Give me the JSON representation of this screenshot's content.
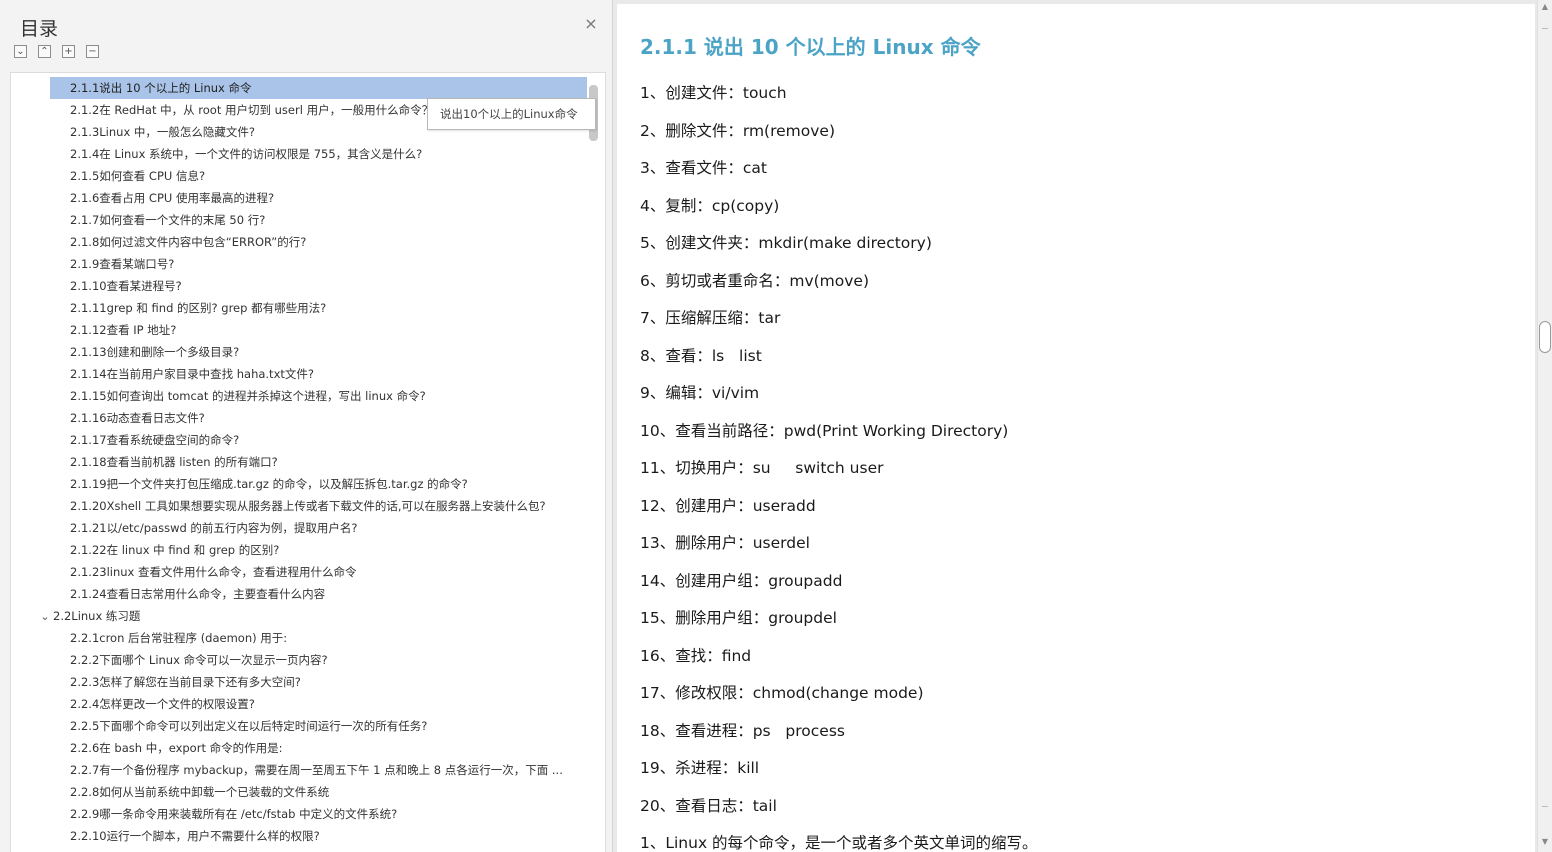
{
  "toc": {
    "title": "目录",
    "close_icon": "×",
    "tools": [
      "⌄",
      "⌃",
      "+",
      "−"
    ],
    "tooltip": "说出10个以上的Linux命令",
    "items": [
      {
        "label": "2.1.1说出 10 个以上的 Linux 命令",
        "level": 2,
        "selected": true
      },
      {
        "label": "2.1.2在 RedHat 中，从 root 用户切到 userl 用户，一般用什么命令？",
        "level": 2
      },
      {
        "label": "2.1.3Linux 中，一般怎么隐藏文件?",
        "level": 2
      },
      {
        "label": "2.1.4在 Linux 系统中，一个文件的访问权限是 755，其含义是什么?",
        "level": 2
      },
      {
        "label": "2.1.5如何查看 CPU 信息?",
        "level": 2
      },
      {
        "label": "2.1.6查看占用 CPU 使用率最高的进程?",
        "level": 2
      },
      {
        "label": "2.1.7如何查看一个文件的末尾 50 行?",
        "level": 2
      },
      {
        "label": "2.1.8如何过滤文件内容中包含“ERROR”的行?",
        "level": 2
      },
      {
        "label": "2.1.9查看某端口号?",
        "level": 2
      },
      {
        "label": "2.1.10查看某进程号?",
        "level": 2
      },
      {
        "label": "2.1.11grep 和 find 的区别? grep 都有哪些用法?",
        "level": 2
      },
      {
        "label": "2.1.12查看 IP 地址?",
        "level": 2
      },
      {
        "label": "2.1.13创建和删除一个多级目录?",
        "level": 2
      },
      {
        "label": "2.1.14在当前用户家目录中查找 haha.txt文件?",
        "level": 2
      },
      {
        "label": "2.1.15如何查询出 tomcat 的进程并杀掉这个进程，写出 linux 命令?",
        "level": 2
      },
      {
        "label": "2.1.16动态查看日志文件?",
        "level": 2
      },
      {
        "label": "2.1.17查看系统硬盘空间的命令?",
        "level": 2
      },
      {
        "label": "2.1.18查看当前机器  listen  的所有端口?",
        "level": 2
      },
      {
        "label": "2.1.19把一个文件夹打包压缩成.tar.gz  的命令，以及解压拆包.tar.gz  的命令?",
        "level": 2
      },
      {
        "label": "2.1.20Xshell  工具如果想要实现从服务器上传或者下载文件的话,可以在服务器上安装什么包?",
        "level": 2
      },
      {
        "label": "2.1.21以/etc/passwd  的前五行内容为例，提取用户名?",
        "level": 2
      },
      {
        "label": "2.1.22在  linux  中  find  和 grep  的区别?",
        "level": 2
      },
      {
        "label": "2.1.23linux 查看文件用什么命令，查看进程用什么命令",
        "level": 2
      },
      {
        "label": "2.1.24查看日志常用什么命令，主要查看什么内容",
        "level": 2
      },
      {
        "label": "2.2Linux 练习题",
        "level": 1,
        "expanded": true
      },
      {
        "label": "2.2.1cron  后台常驻程序  (daemon)  用于:",
        "level": 2
      },
      {
        "label": "2.2.2下面哪个 Linux 命令可以一次显示一页内容?",
        "level": 2
      },
      {
        "label": "2.2.3怎样了解您在当前目录下还有多大空间?",
        "level": 2
      },
      {
        "label": "2.2.4怎样更改一个文件的权限设置?",
        "level": 2
      },
      {
        "label": "2.2.5下面哪个命令可以列出定义在以后特定时间运行一次的所有任务?",
        "level": 2
      },
      {
        "label": "2.2.6在 bash 中，export 命令的作用是:",
        "level": 2
      },
      {
        "label": "2.2.7有一个备份程序 mybackup，需要在周一至周五下午 1 点和晚上 8 点各运行一次，下面 ...",
        "level": 2
      },
      {
        "label": "2.2.8如何从当前系统中卸载一个已装载的文件系统",
        "level": 2
      },
      {
        "label": "2.2.9哪一条命令用来装载所有在  /etc/fstab  中定义的文件系统?",
        "level": 2
      },
      {
        "label": "2.2.10运行一个脚本，用户不需要什么样的权限?",
        "level": 2
      }
    ]
  },
  "doc": {
    "heading": "2.1.1  说出 10 个以上的 Linux 命令",
    "heading_color": "#4ba3c6",
    "lines": [
      "1、创建文件：touch",
      "2、删除文件：rm(remove)",
      "3、查看文件：cat",
      "4、复制：cp(copy)",
      "5、创建文件夹：mkdir(make directory)",
      "6、剪切或者重命名：mv(move)",
      "7、压缩解压缩：tar",
      "8、查看：ls   list",
      "9、编辑：vi/vim",
      "10、查看当前路径：pwd(Print Working Directory)",
      "11、切换用户：su     switch user",
      "12、创建用户：useradd",
      "13、删除用户：userdel",
      "14、创建用户组：groupadd",
      "15、删除用户组：groupdel",
      "16、查找：find",
      "17、修改权限：chmod(change mode)",
      "18、查看进程：ps   process",
      "19、杀进程：kill",
      "20、查看日志：tail",
      "1、Linux 的每个命令，是一个或者多个英文单词的缩写。"
    ]
  },
  "icons": {
    "close": "close-icon",
    "collapse_all": "collapse-all-icon",
    "expand_all": "expand-all-icon",
    "add": "add-icon",
    "remove": "remove-icon",
    "chevron_down": "chevron-down-icon"
  }
}
